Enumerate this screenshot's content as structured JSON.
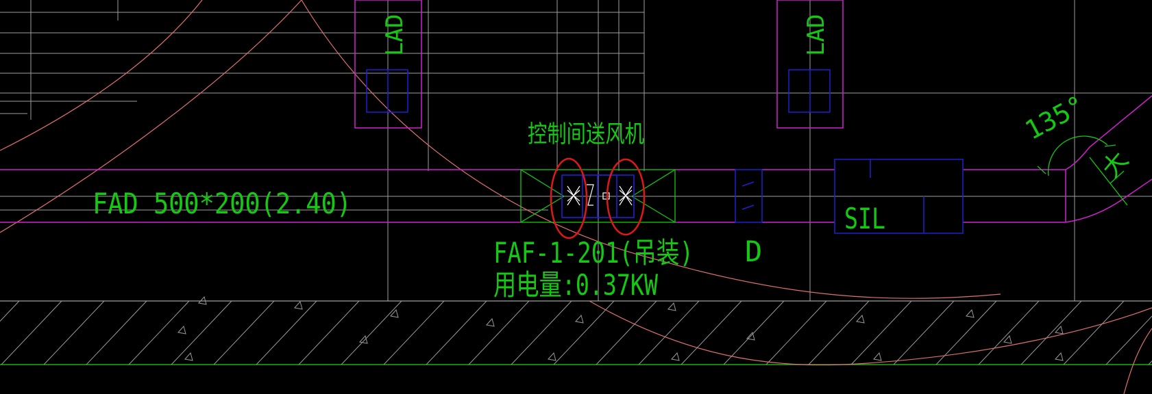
{
  "drawing": {
    "background": "#000000",
    "colors": {
      "grid": "#a0a0a0",
      "duct": "#d020d0",
      "equipment": "#2020d0",
      "text": "#14c814",
      "curve": "#e07070",
      "highlight": "#e01818",
      "hatch": "#9a9a9a",
      "ground_line": "#18b018",
      "fan_symbol": "#ffffff"
    },
    "labels": {
      "lad_left": "LAD",
      "lad_right": "LAD",
      "fan_room": "控制间送风机",
      "duct_spec": "FAD 500*200(2.40)",
      "fan_tag": "FAF-1-201(吊装)",
      "power": "用电量:0.37KW",
      "damper_tag": "D",
      "silencer_tag": "SIL",
      "angle": "135°",
      "cut_text": "大"
    }
  }
}
